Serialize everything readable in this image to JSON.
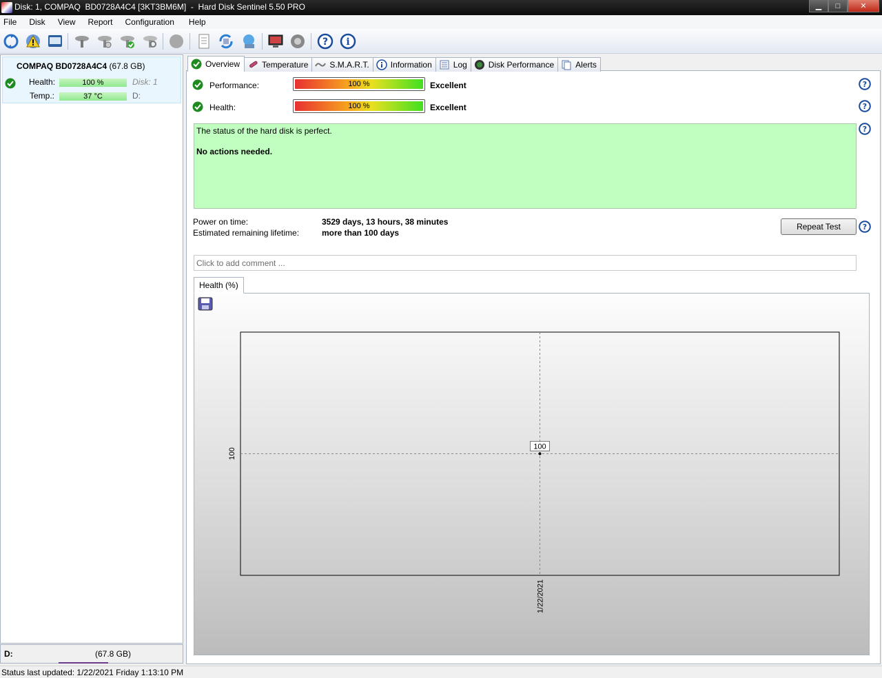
{
  "window": {
    "title": "Disk: 1, COMPAQ  BD0728A4C4 [3KT3BM6M]  -  Hard Disk Sentinel 5.50 PRO",
    "minimize": "▁",
    "maximize": "□",
    "close": "✕"
  },
  "menu": [
    "File",
    "Disk",
    "View",
    "Report",
    "Configuration",
    "Help"
  ],
  "disk_list": {
    "name": "COMPAQ  BD0728A4C4",
    "size": "(67.8 GB)",
    "health_label": "Health:",
    "health_value": "100 %",
    "health_percent": 100,
    "temp_label": "Temp.:",
    "temp_value": "37 °C",
    "disk_index": "Disk: 1",
    "drive_letter": "D:"
  },
  "volume": {
    "letter": "D:",
    "size": "(67.8 GB)"
  },
  "status_bar": "Status last updated: 1/22/2021 Friday 1:13:10 PM",
  "tabs": [
    {
      "label": "Overview",
      "icon": "check-icon",
      "active": true
    },
    {
      "label": "Temperature",
      "icon": "thermometer-icon",
      "active": false
    },
    {
      "label": "S.M.A.R.T.",
      "icon": "smart-icon",
      "active": false
    },
    {
      "label": "Information",
      "icon": "info-icon",
      "active": false
    },
    {
      "label": "Log",
      "icon": "log-icon",
      "active": false
    },
    {
      "label": "Disk Performance",
      "icon": "gauge-icon",
      "active": false
    },
    {
      "label": "Alerts",
      "icon": "alerts-icon",
      "active": false
    }
  ],
  "overview": {
    "performance": {
      "label": "Performance:",
      "bar_text": "100 %",
      "percent": 100,
      "rating": "Excellent"
    },
    "health": {
      "label": "Health:",
      "bar_text": "100 %",
      "percent": 100,
      "rating": "Excellent"
    },
    "status_line1": "The status of the hard disk is perfect.",
    "status_line2": "No actions needed.",
    "power_on_label": "Power on time:",
    "power_on_value": "3529 days, 13 hours, 38 minutes",
    "lifetime_label": "Estimated remaining lifetime:",
    "lifetime_value": "more than 100 days",
    "repeat_test": "Repeat Test",
    "comment_placeholder": "Click to add comment ...",
    "chart_tab": "Health (%)"
  },
  "colors": {
    "status_bg": "#c0ffc0",
    "ok_green": "#1f8a1f",
    "help_blue": "#1b4c9c"
  },
  "chart_data": {
    "type": "line",
    "x": [
      "1/22/2021"
    ],
    "series": [
      {
        "values": [
          100
        ]
      }
    ],
    "point_labels": [
      "100"
    ],
    "y_tick_labels": [
      "100"
    ],
    "x_tick_labels": [
      "1/22/2021"
    ],
    "grid": true
  }
}
